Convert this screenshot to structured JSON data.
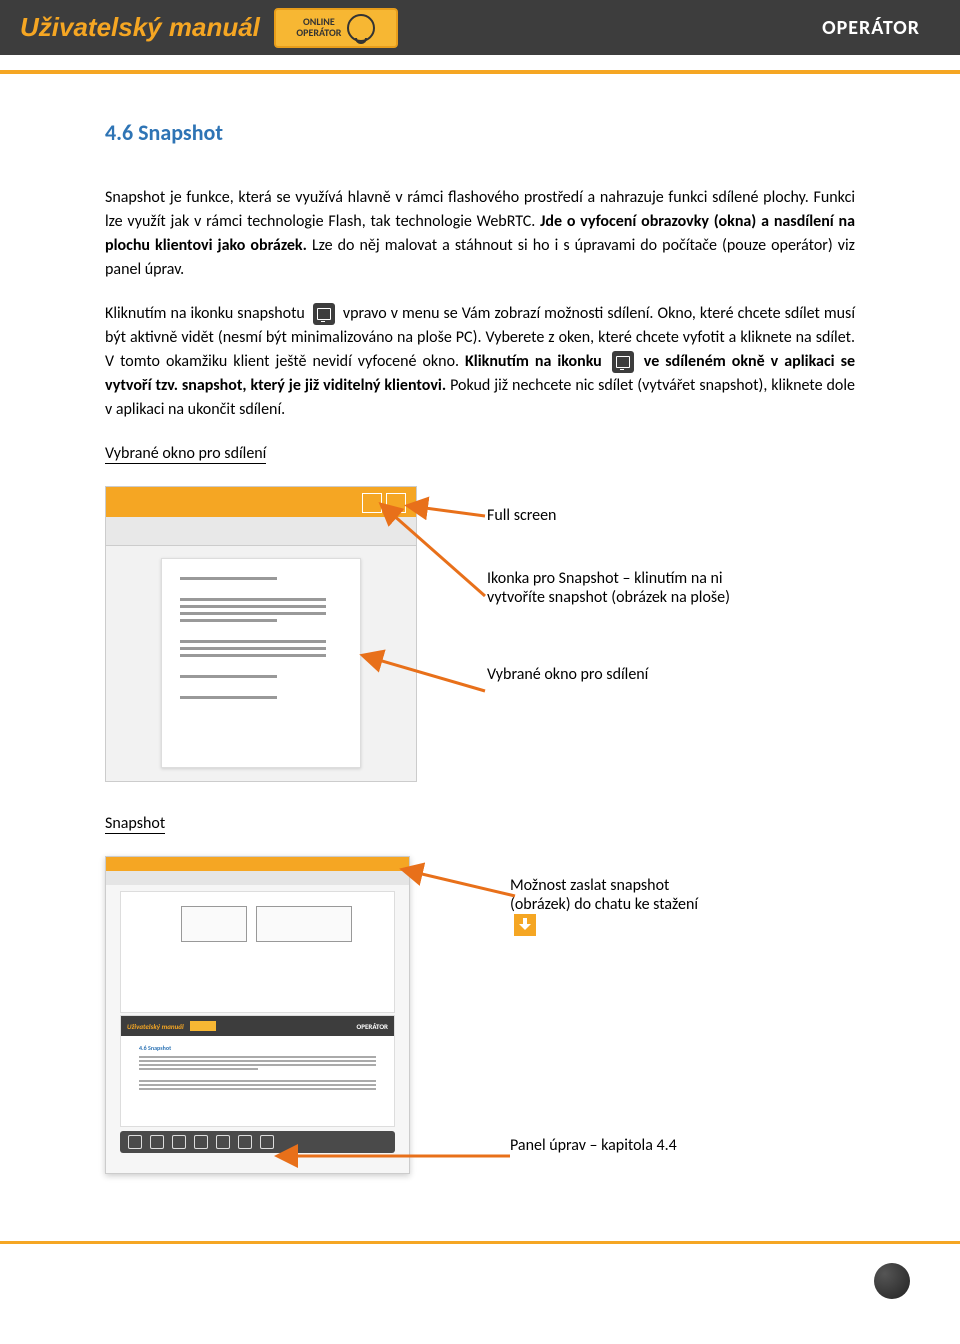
{
  "header": {
    "brand": "Uživatelský manuál",
    "badge_line1": "ONLINE",
    "badge_line2": "OPERÁTOR",
    "role": "OPERÁTOR"
  },
  "section": {
    "number_title": "4.6 Snapshot",
    "para1": "Snapshot je funkce, která se využívá hlavně v rámci flashového prostředí a nahrazuje funkci sdílené plochy. Funkci lze využít jak v rámci technologie Flash, tak technologie WebRTC. ",
    "para1_bold": "Jde o vyfocení obrazovky (okna) a nasdílení na plochu klientovi jako obrázek.",
    "para1_tail": " Lze do něj malovat a stáhnout si ho i s úpravami do počítače (pouze operátor) viz panel úprav.",
    "para2_a": "Kliknutím na ikonku snapshotu ",
    "para2_b": " vpravo v menu se Vám zobrazí možnosti sdílení. Okno, které chcete sdílet musí být aktivně vidět (nesmí být minimalizováno na ploše PC). Vyberete z oken, které chcete vyfotit a kliknete na sdílet. V tomto okamžiku klient ještě nevidí vyfocené okno. ",
    "para2_bold1": "Kliknutím na ikonku ",
    "para2_bold2": " ve sdíleném okně v aplikaci se vytvoří tzv. snapshot, který je již viditelný klientovi.",
    "para2_tail": " Pokud již nechcete nic sdílet (vytvářet snapshot), kliknete dole v aplikaci na ukončit sdílení.",
    "caption1": "Vybrané okno pro sdílení",
    "annot_fullscreen": "Full screen",
    "annot_snapshot_icon": "Ikonka pro Snapshot – klinutím na ni vytvoříte snapshot (obrázek na ploše)",
    "annot_selected_window": "Vybrané okno pro sdílení",
    "caption2": "Snapshot",
    "annot_send_snapshot": "Možnost zaslat snapshot (obrázek) do chatu ke stažení",
    "annot_toolbar": "Panel úprav – kapitola 4.4"
  },
  "nested_manual": {
    "title": "Uživatelský manuál",
    "role": "OPERÁTOR",
    "heading": "4.6 Snapshot"
  }
}
